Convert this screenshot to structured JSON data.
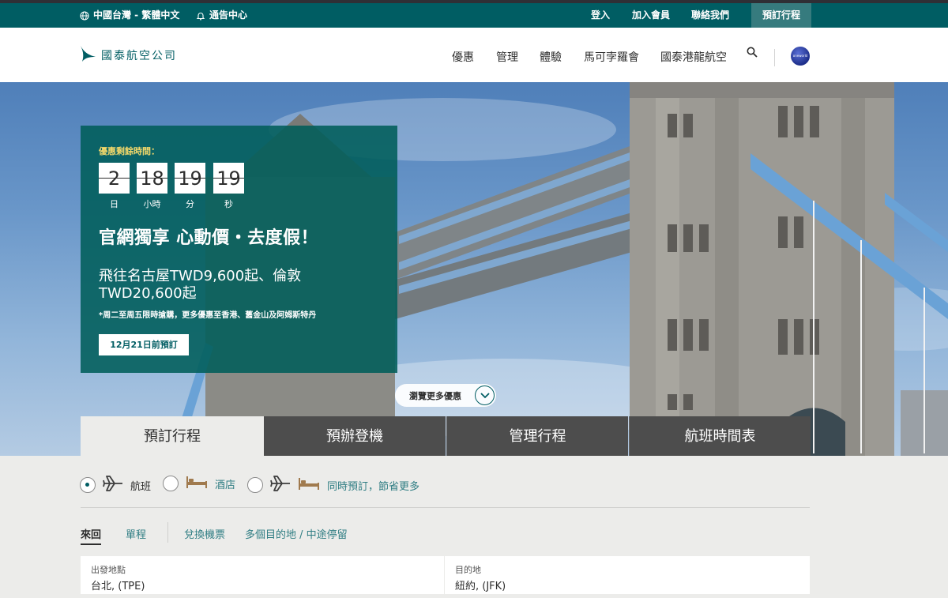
{
  "utility": {
    "region": "中國台灣 - 繁體中文",
    "notices": "通告中心",
    "login": "登入",
    "join": "加入會員",
    "contact": "聯絡我們",
    "book_trip": "預訂行程"
  },
  "header": {
    "logo_text": "國泰航空公司",
    "nav": [
      "優惠",
      "管理",
      "體驗",
      "馬可孛羅會",
      "國泰港龍航空"
    ],
    "oneworld_label": "oneworld"
  },
  "promo": {
    "countdown_label": "優惠剩餘時間：",
    "countdown": [
      {
        "value": "2",
        "unit": "日"
      },
      {
        "value": "18",
        "unit": "小時"
      },
      {
        "value": "19",
        "unit": "分"
      },
      {
        "value": "19",
        "unit": "秒"
      }
    ],
    "headline": "官網獨享 心動價・去度假！",
    "subhead": "飛往名古屋TWD9,600起、倫敦TWD20,600起",
    "note": "*周二至周五限時搶購，更多優惠至香港、舊金山及阿姆斯特丹",
    "cta": "12月21日前預訂"
  },
  "more_deals": "瀏覽更多優惠",
  "tabs": [
    "預訂行程",
    "預辦登機",
    "管理行程",
    "航班時間表"
  ],
  "booking": {
    "options": [
      {
        "label": "航班",
        "selected": true
      },
      {
        "label": "酒店",
        "selected": false
      },
      {
        "label": "同時預訂，節省更多",
        "selected": false
      }
    ],
    "trip_types": [
      "來回",
      "單程",
      "兌換機票",
      "多個目的地 / 中途停留"
    ],
    "origin_label": "出發地點",
    "origin_value": "台北, (TPE)",
    "dest_label": "目的地",
    "dest_value": "紐約, (JFK)"
  },
  "colors": {
    "brand_teal": "#005d63",
    "accent_yellow": "#f3d86a",
    "tab_dark": "#4d4d4d"
  }
}
